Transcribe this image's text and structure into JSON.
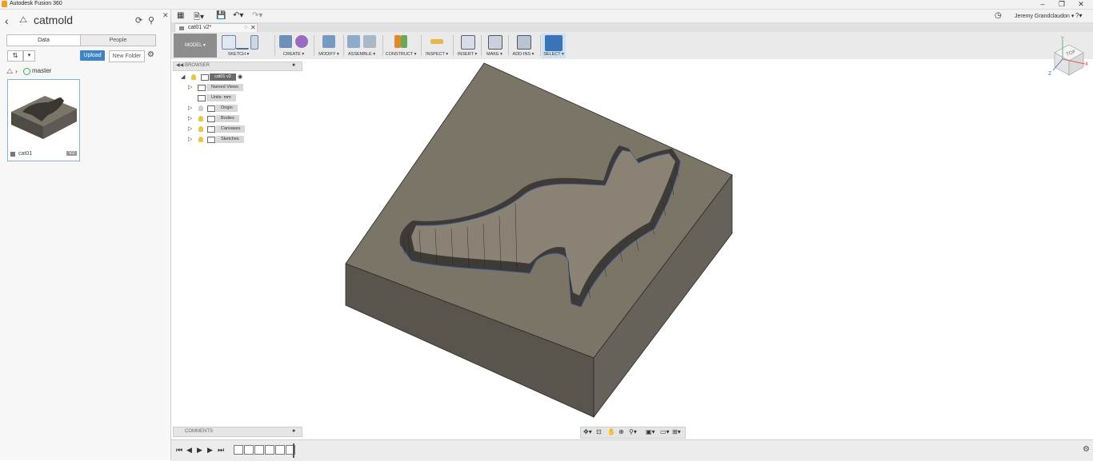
{
  "window": {
    "title": "Autodesk Fusion 360",
    "minimize_icon": "minimize-icon",
    "maximize_icon": "restore-icon",
    "close_icon": "close-icon"
  },
  "data_panel": {
    "project_title": "catmold",
    "tabs": [
      "Data",
      "People"
    ],
    "upload_label": "Upload",
    "new_folder_label": "New Folder",
    "branch": "master",
    "item": {
      "name": "cat01",
      "version": "V2"
    }
  },
  "appbar": {
    "user_name": "Jeremy Grandclaudon ▾",
    "help_label": "?▾"
  },
  "document_tab": {
    "label": "cat01 v2*"
  },
  "toolbar": {
    "workspace": "MODEL ▾",
    "groups": [
      "SKETCH ▾",
      "CREATE ▾",
      "MODIFY ▾",
      "ASSEMBLE ▾",
      "CONSTRUCT ▾",
      "INSPECT ▾",
      "INSERT ▾",
      "MAKE ▾",
      "ADD-INS ▾",
      "SELECT ▾"
    ]
  },
  "browser": {
    "label": "BROWSER",
    "root": "cat01 v2",
    "nodes": [
      "Named Views",
      "Units: mm",
      "Origin",
      "Bodies",
      "Canvases",
      "Sketches"
    ]
  },
  "comments": {
    "label": "COMMENTS"
  },
  "viewcube": {
    "face": "TOP",
    "axis_x": "X",
    "axis_y": "Y",
    "axis_z": "Z"
  },
  "colors": {
    "accent": "#3d84c6",
    "block_top": "#7b7568",
    "block_left": "#59554d",
    "block_right": "#66625a",
    "pocket_floor": "#8a8274"
  }
}
